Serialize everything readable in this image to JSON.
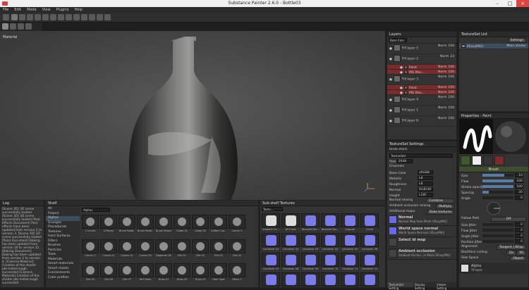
{
  "window": {
    "title": "Substance Painter 2.6.0 - Bottle03"
  },
  "menu": [
    "File",
    "Edit",
    "Mode",
    "View",
    "Plugins",
    "Help"
  ],
  "viewport": {
    "label": "Material"
  },
  "layers": {
    "title": "Layers",
    "blend_select": "Base Colo",
    "items": [
      {
        "name": "Fill layer 5",
        "blend": "Norm",
        "opacity": "100"
      },
      {
        "name": "Fill layer 2",
        "blend": "Norm",
        "opacity": "23"
      },
      {
        "name": "Paint",
        "blend": "Norm",
        "opacity": "100"
      },
      {
        "name": "MG Mas...",
        "blend": "Norm",
        "opacity": "100"
      },
      {
        "name": "Fill layer 3",
        "blend": "Norm",
        "opacity": "100"
      },
      {
        "name": "Paint",
        "blend": "Norm",
        "opacity": "100"
      },
      {
        "name": "MG Mas...",
        "blend": "Norm",
        "opacity": "100"
      },
      {
        "name": "Fill layer 4",
        "blend": "Norm",
        "opacity": "100"
      },
      {
        "name": "Fill layer 1",
        "blend": "Norm",
        "opacity": "100"
      },
      {
        "name": "Fill layer 6",
        "blend": "Norm",
        "opacity": "100"
      }
    ]
  },
  "texture_set_list": {
    "title": "TextureSet List",
    "settings_btn": "Settings",
    "item": "VEasyMtl()",
    "shader": "Main shader"
  },
  "texture_set_settings": {
    "title": "TextureSet Settings",
    "undo": "Undo stack",
    "set_name": "TextureSet",
    "size_label": "Size",
    "size": "2048",
    "channels_label": "Channels",
    "channels": [
      {
        "name": "Base Color",
        "format": "sRGB8"
      },
      {
        "name": "Metallic",
        "format": "L8"
      },
      {
        "name": "Roughness",
        "format": "L8"
      },
      {
        "name": "Normal",
        "format": "RGB16F"
      },
      {
        "name": "Height",
        "format": "L16F"
      }
    ],
    "normal_mixing_label": "Normal mixing",
    "normal_mixing": "Combine",
    "ao_label": "Ambient occlusion mixing",
    "ao_value": "Multiply",
    "additional_label": "Additional maps",
    "bake_btn": "Bake textures",
    "maps": [
      {
        "name": "Normal",
        "desc": "Normal Map from Mesh VEasyMtl()"
      },
      {
        "name": "World space normal",
        "desc": "World Space Normals VEasyMtl()"
      },
      {
        "name": "Select id map",
        "desc": ""
      },
      {
        "name": "Ambient occlusion",
        "desc": "Ambient Occlus...m Mesh VEasyMtl()"
      }
    ],
    "tabs": [
      "TextureSet Setting",
      "Display Setting",
      "Viewer Setting"
    ]
  },
  "properties": {
    "title": "Properties - Paint",
    "brush_title": "Brush",
    "slots": [
      "brush",
      "alpha",
      "stencil",
      "Material"
    ],
    "params": [
      {
        "name": "Size",
        "value": "10",
        "fill": 0.7
      },
      {
        "name": "Flow",
        "value": "100",
        "fill": 1.0
      },
      {
        "name": "Stroke opacity",
        "value": "100",
        "fill": 1.0
      },
      {
        "name": "Spacing",
        "value": "20",
        "fill": 0.2
      },
      {
        "name": "Angle",
        "value": "0",
        "fill": 0
      }
    ],
    "follow_path_label": "Follow Path",
    "follow_path": "Off",
    "jitters": [
      {
        "name": "Size Jitter",
        "value": "0"
      },
      {
        "name": "Flow Jitter",
        "value": "0"
      },
      {
        "name": "Angle Jitter",
        "value": "0"
      },
      {
        "name": "Position Jitter",
        "value": "0"
      }
    ],
    "alignment_label": "Alignment",
    "alignment": "Tangent | Wrap",
    "backface_label": "Backface culling",
    "backface": "On",
    "backface_val": "90",
    "size_space_label": "Size Space",
    "size_space": "Object",
    "alpha_title": "Alpha",
    "alpha_sub": "Shape"
  },
  "log": {
    "title": "Log",
    "text": "[Scene 3D] 3D scene successfully loaded [Scene 3D] 3D scene successfully loaded [Post Effects Document] Post effects have been updated from version 2 to version 3. [Scene 3D] 3D scene successfully loaded [Paint Document] Baking has been updated from version 30 to version 32. [Baking Document] Baking has been updated from version 2 to version 4. [Camera Material] Creation of the shader pbr-metal-rough succeeded [Camera Material] Creation of the shader pbr-metal-rough succeeded"
  },
  "shelf": {
    "title": "Shelf",
    "search": "Alphas",
    "categories": [
      "All",
      "Project",
      "Alphas",
      "Grunges",
      "Procedurals",
      "Textures",
      "Hard Surfaces",
      "Filters",
      "Brushes",
      "Particles",
      "Tools",
      "Materials",
      "Smart materials",
      "Smart masks",
      "Environments",
      "Color profiles"
    ],
    "items": [
      "1 Circles",
      "4 Marks",
      "Brush Rotat...",
      "Brush Rotat...",
      "Brush Stroke...",
      "Claws 01",
      "Claws 02",
      "Coffee Cup...",
      "Corner 1",
      "Corner 2",
      "Cracks 01",
      "Cracks 02",
      "Cracks 03",
      "Dagamer Dir...",
      "Dirt 01",
      "Dirt 02",
      "Dirt 03",
      "Dirt 04",
      "Dirt 05",
      "Dirt 06",
      "Dirt 07",
      "Dirt Stain",
      "Drips 01",
      "Drips 02",
      "Drips 03",
      "Fiber Spot",
      "Fibers 1"
    ]
  },
  "subshelf": {
    "title": "Sub-shelf Textures",
    "search": "Textu...",
    "items": [
      "Ambient Oc...",
      "ATX text",
      "Beveled Rec...",
      "Beveled Rec...",
      "Capsule",
      "Circle",
      "Container 01",
      "Container 02",
      "Container 03",
      "Container 04",
      "Container 05",
      "Container 06",
      "Container 07",
      "Container 08",
      "Container 09",
      "Container 10",
      "Container 11",
      "Container 12",
      "Container 13",
      "Container 14",
      "Container 15",
      "Container 16",
      "Container 17",
      "Container 18"
    ]
  },
  "colors": {
    "accent": "#5a7aa8",
    "selected": "#7a2b2b",
    "brush_header": "#3d4d2d"
  }
}
